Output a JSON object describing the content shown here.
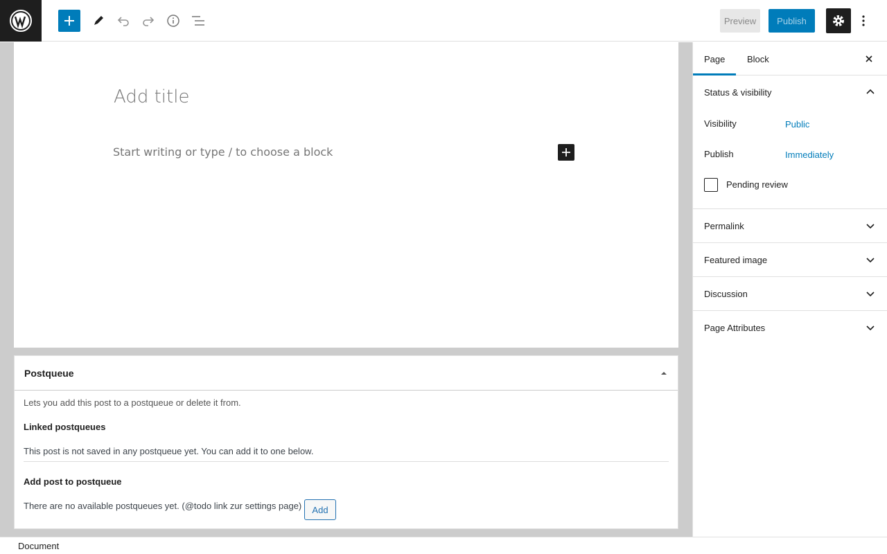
{
  "toolbar": {
    "logo_icon": "wordpress-logo-icon",
    "add_icon": "plus-icon",
    "tools_icon": "pencil-icon",
    "undo_icon": "undo-icon",
    "redo_icon": "redo-icon",
    "info_icon": "info-icon",
    "outline_icon": "list-view-icon",
    "preview_label": "Preview",
    "publish_label": "Publish",
    "settings_icon": "gear-icon",
    "more_icon": "more-vertical-icon"
  },
  "editor": {
    "title_placeholder": "Add title",
    "paragraph_placeholder": "Start writing or type / to choose a block"
  },
  "metabox": {
    "title": "Postqueue",
    "description": "Lets you add this post to a postqueue or delete it from.",
    "linked_heading": "Linked postqueues",
    "linked_note": "This post is not saved in any postqueue yet. You can add it to one below.",
    "add_heading": "Add post to postqueue",
    "none_note": "There are no available postqueues yet. (@todo link zur settings page)",
    "add_button": "Add"
  },
  "sidebar": {
    "tabs": [
      {
        "label": "Page",
        "active": true
      },
      {
        "label": "Block",
        "active": false
      }
    ],
    "status_panel": {
      "title": "Status & visibility",
      "visibility_label": "Visibility",
      "visibility_value": "Public",
      "publish_label": "Publish",
      "publish_value": "Immediately",
      "pending_label": "Pending review"
    },
    "panels": [
      {
        "title": "Permalink"
      },
      {
        "title": "Featured image"
      },
      {
        "title": "Discussion"
      },
      {
        "title": "Page Attributes"
      }
    ]
  },
  "footer": {
    "breadcrumb": "Document"
  },
  "colors": {
    "accent": "#007cba",
    "dark": "#1e1e1e"
  }
}
